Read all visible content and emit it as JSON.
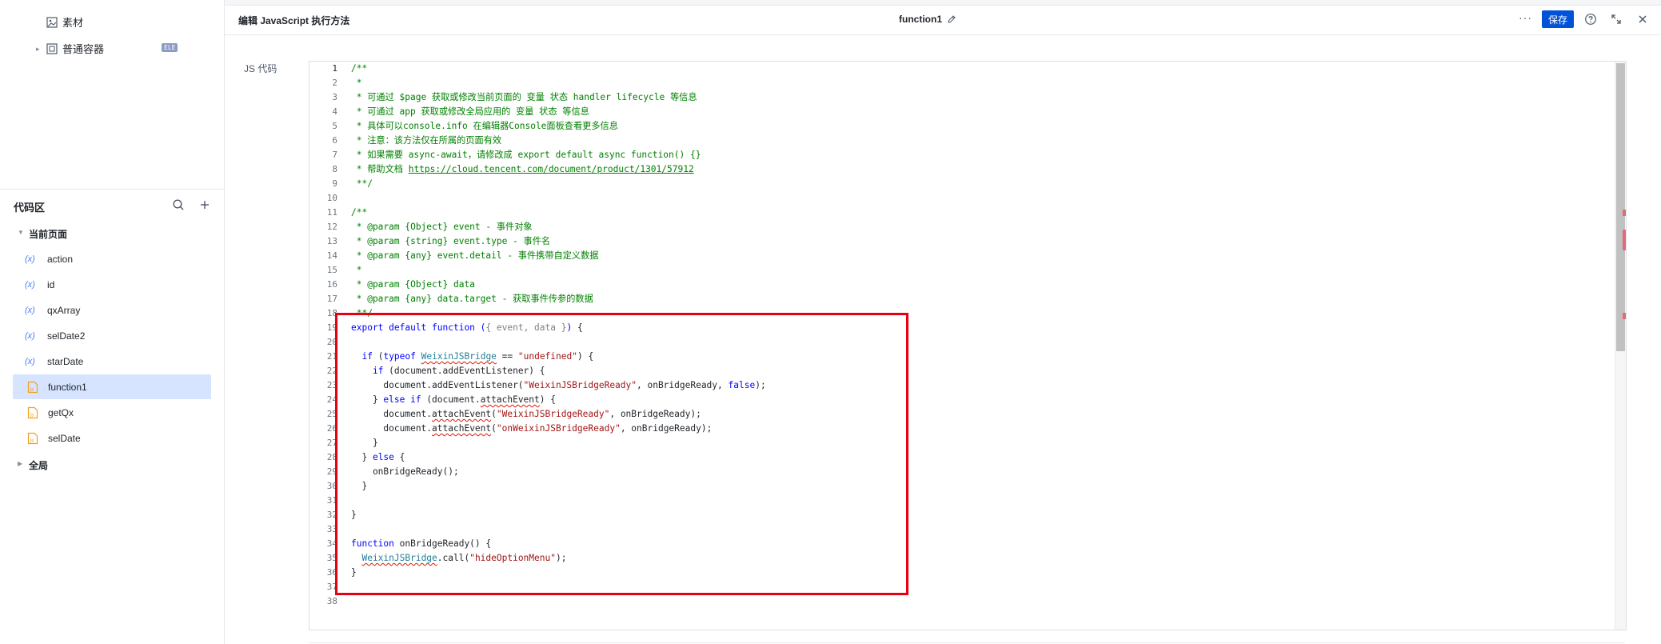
{
  "sidebar": {
    "tree_items": [
      {
        "label": "素材"
      },
      {
        "label": "普通容器",
        "badge": "ELE"
      }
    ],
    "code_area": {
      "title": "代码区",
      "groups": {
        "current_page": "当前页面",
        "global": "全局"
      },
      "items": [
        {
          "label": "action",
          "type": "variable",
          "icon": "variable-icon"
        },
        {
          "label": "id",
          "type": "variable",
          "icon": "variable-icon"
        },
        {
          "label": "qxArray",
          "type": "variable",
          "icon": "variable-icon"
        },
        {
          "label": "selDate2",
          "type": "variable",
          "icon": "variable-icon"
        },
        {
          "label": "starDate",
          "type": "variable",
          "icon": "variable-icon"
        },
        {
          "label": "function1",
          "type": "function",
          "icon": "function-file-icon",
          "active": true
        },
        {
          "label": "getQx",
          "type": "function",
          "icon": "function-file-icon"
        },
        {
          "label": "selDate",
          "type": "function",
          "icon": "function-file-icon"
        }
      ],
      "var_icon_text": "(x)"
    }
  },
  "toolbar": {
    "title": "编辑 JavaScript 执行方法",
    "function_name": "function1",
    "more": "···",
    "save_label": "保存"
  },
  "editor": {
    "label": "JS 代码",
    "current_line": 1,
    "line_count": 38
  },
  "colors": {
    "accent": "#0052d9",
    "active_item_bg": "#d6e4ff",
    "highlight_box": "#e60012",
    "comment": "#008000",
    "keyword": "#0000ff",
    "string": "#a31515"
  }
}
